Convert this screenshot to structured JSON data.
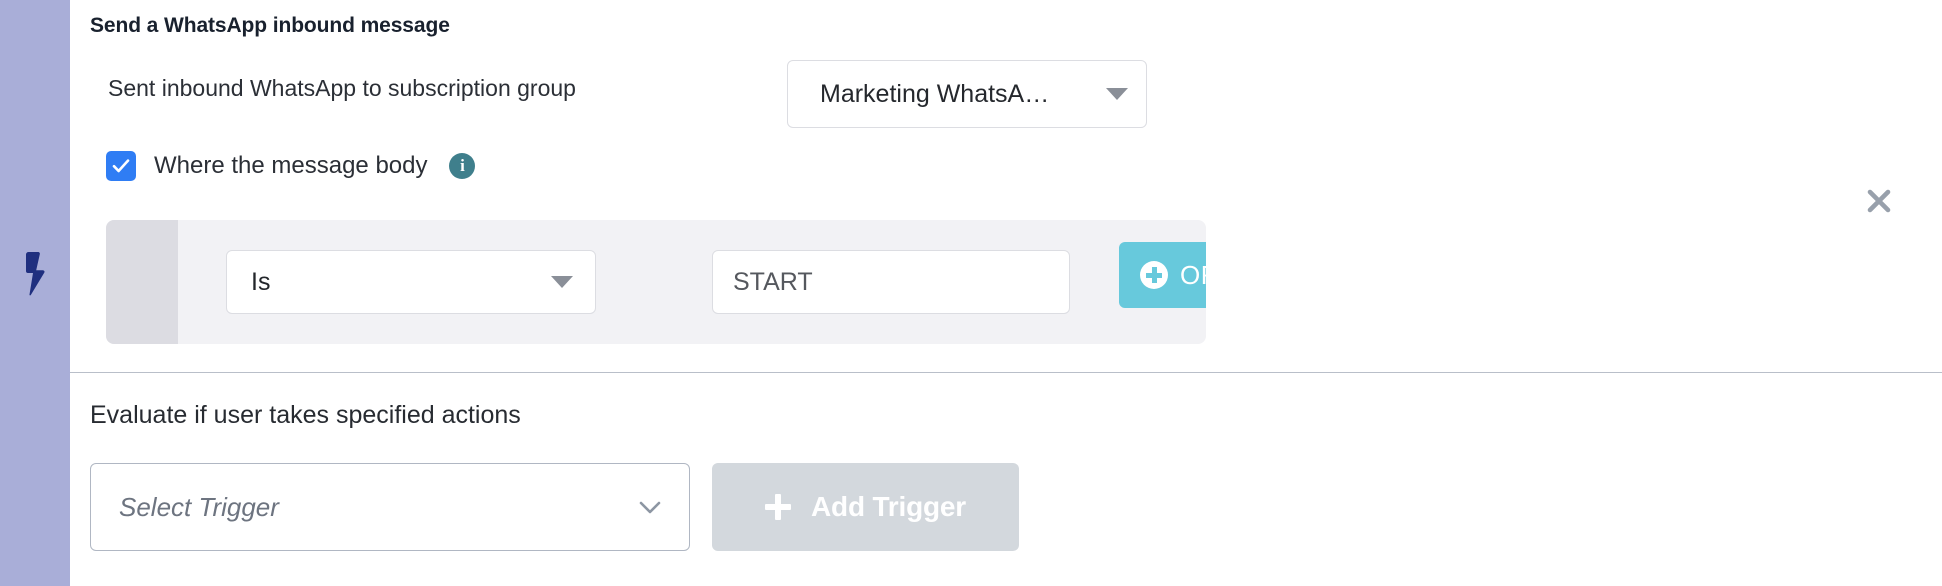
{
  "sidebar": {
    "icon": "lightning-bolt-icon",
    "background_color": "#a9aed8",
    "icon_color": "#1f2f7f"
  },
  "trigger_section": {
    "title": "Send a WhatsApp inbound message",
    "subscription_row": {
      "label": "Sent inbound WhatsApp to subscription group",
      "dropdown": {
        "value": "Marketing WhatsA…",
        "icon": "caret-down-icon"
      }
    },
    "message_body_filter": {
      "checked": true,
      "checkbox_color": "#2f7df4",
      "label": "Where the message body",
      "info_icon": "info-icon",
      "info_icon_color": "#3f7f8c",
      "info_glyph": "i"
    },
    "condition_row": {
      "operator": {
        "value": "Is",
        "icon": "caret-down-icon"
      },
      "value_input": {
        "value": "START",
        "placeholder": "START"
      },
      "or_button": {
        "label": "OR",
        "icon": "plus-circle-icon",
        "color": "#67c9dc"
      },
      "remove_icon": "close-x-icon"
    },
    "close_icon": "close-x-icon",
    "close_icon_color": "#98a0ab"
  },
  "actions_section": {
    "title": "Evaluate if user takes specified actions",
    "trigger_select": {
      "placeholder": "Select Trigger",
      "icon": "chevron-down-icon"
    },
    "add_trigger_button": {
      "label": "Add Trigger",
      "icon": "plus-icon",
      "disabled": true,
      "color": "#d3d8dd"
    }
  }
}
